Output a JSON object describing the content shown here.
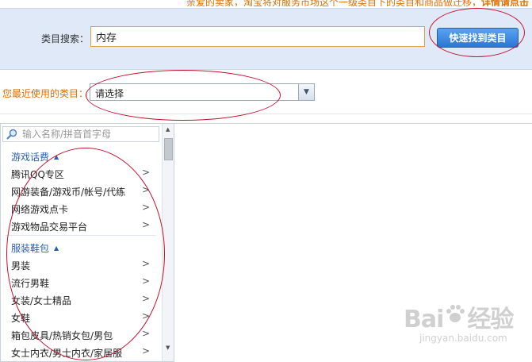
{
  "notice": {
    "text": "亲爱的卖家，淘宝将对服务市场这个一级类目下的类目和商品做迁移，",
    "link": "详情请点击"
  },
  "search": {
    "label": "类目搜索：",
    "value": "内存",
    "button": "快速找到类目"
  },
  "recent": {
    "label": "您最近使用的类目：",
    "selected": "请选择"
  },
  "filter": {
    "placeholder": "输入名称/拼音首字母",
    "icon": "search-icon"
  },
  "tree": {
    "groups": [
      {
        "title": "游戏话费",
        "items": [
          "腾讯QQ专区",
          "网游装备/游戏币/帐号/代练",
          "网络游戏点卡",
          "游戏物品交易平台"
        ]
      },
      {
        "title": "服装鞋包",
        "items": [
          "男装",
          "流行男鞋",
          "女装/女士精品",
          "女鞋",
          "箱包皮具/热销女包/男包",
          "女士内衣/男士内衣/家居服"
        ]
      }
    ],
    "chevron": ">"
  },
  "watermark": {
    "main": "Bai",
    "main2": "经验",
    "sub": "jingyan.baidu.com"
  },
  "colors": {
    "accent": "#e07000",
    "link": "#2a5fb0",
    "button": "#2a76d2",
    "annotation": "#c8102e"
  }
}
